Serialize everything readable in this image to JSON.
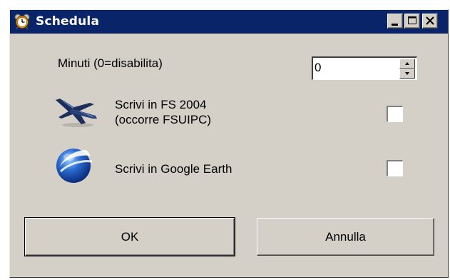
{
  "window": {
    "title": "Schedula",
    "title_icon": "alarm-clock-icon",
    "controls": [
      "minimize-icon",
      "maximize-icon",
      "close-icon"
    ]
  },
  "form": {
    "minutes_label": "Minuti (0=disabilita)",
    "minutes_value": "0",
    "fs_label_line1": "Scrivi in FS 2004",
    "fs_label_line2": "(occorre FSUIPC)",
    "fs_checked": false,
    "fs_icon": "airplane-icon",
    "ge_label": "Scrivi in Google Earth",
    "ge_checked": false,
    "ge_icon": "google-earth-globe-icon"
  },
  "buttons": {
    "ok": "OK",
    "cancel": "Annulla"
  },
  "colors": {
    "titlebar": "#0a246a",
    "face": "#d4d0c8"
  }
}
